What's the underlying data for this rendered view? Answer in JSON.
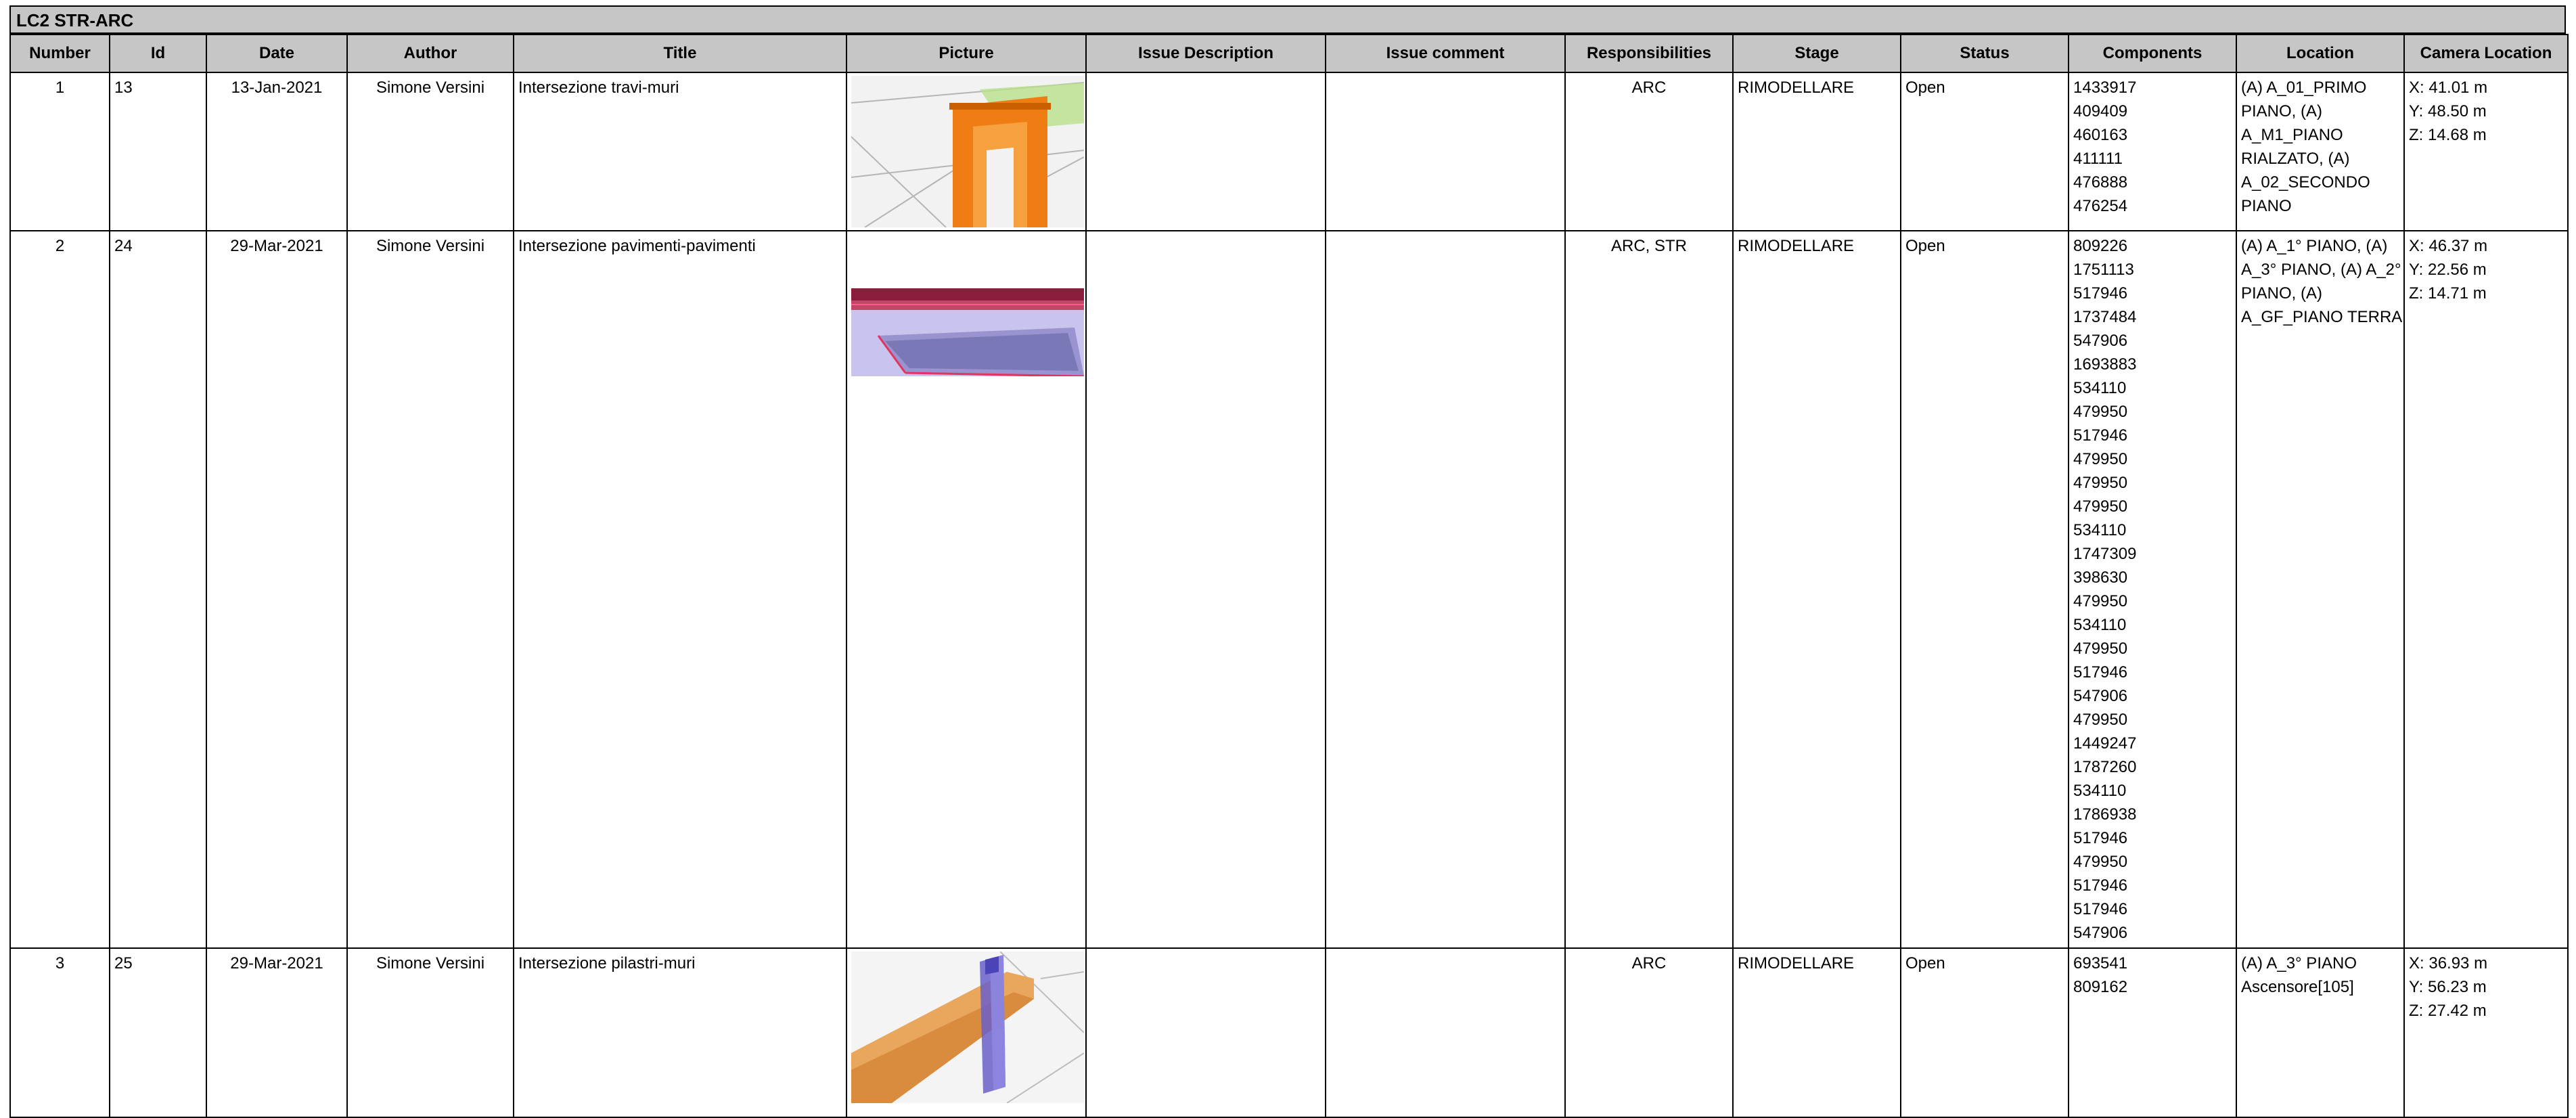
{
  "report": {
    "title": "LC2 STR-ARC"
  },
  "columns": [
    "Number",
    "Id",
    "Date",
    "Author",
    "Title",
    "Picture",
    "Issue Description",
    "Issue comment",
    "Responsibilities",
    "Stage",
    "Status",
    "Components",
    "Location",
    "Camera Location"
  ],
  "rows": [
    {
      "number": "1",
      "id": "13",
      "date": "13-Jan-2021",
      "author": "Simone Versini",
      "title": "Intersezione travi-muri",
      "issue_description": "",
      "issue_comment": "",
      "responsibilities": "ARC",
      "stage": "RIMODELLARE",
      "status": "Open",
      "components": [
        "1433917",
        "409409",
        "460163",
        "411111",
        "476888",
        "476254"
      ],
      "location": [
        "(A) A_01_PRIMO",
        "PIANO, (A)",
        "A_M1_PIANO",
        "RIALZATO, (A)",
        "A_02_SECONDO",
        "PIANO"
      ],
      "camera": [
        "X: 41.01 m",
        "Y: 48.50 m",
        "Z: 14.68 m"
      ],
      "picture_icon": "orange-beam-wall-clash-render"
    },
    {
      "number": "2",
      "id": "24",
      "date": "29-Mar-2021",
      "author": "Simone Versini",
      "title": "Intersezione pavimenti-pavimenti",
      "issue_description": "",
      "issue_comment": "",
      "responsibilities": "ARC, STR",
      "stage": "RIMODELLARE",
      "status": "Open",
      "components": [
        "809226",
        "1751113",
        "517946",
        "1737484",
        "547906",
        "1693883",
        "534110",
        "479950",
        "517946",
        "479950",
        "479950",
        "479950",
        "534110",
        "1747309",
        "398630",
        "479950",
        "534110",
        "479950",
        "517946",
        "547906",
        "479950",
        "1449247",
        "1787260",
        "534110",
        "1786938",
        "517946",
        "479950",
        "517946",
        "517946",
        "547906"
      ],
      "location": [
        "(A) A_1° PIANO, (A)",
        "A_3° PIANO, (A) A_2°",
        "PIANO, (A)",
        "A_GF_PIANO TERRA"
      ],
      "camera": [
        "X: 46.37 m",
        "Y: 22.56 m",
        "Z: 14.71 m"
      ],
      "picture_icon": "purple-floor-slab-clash-render"
    },
    {
      "number": "3",
      "id": "25",
      "date": "29-Mar-2021",
      "author": "Simone Versini",
      "title": "Intersezione pilastri-muri",
      "issue_description": "",
      "issue_comment": "",
      "responsibilities": "ARC",
      "stage": "RIMODELLARE",
      "status": "Open",
      "components": [
        "693541",
        "809162"
      ],
      "location": [
        "(A) A_3° PIANO",
        "Ascensore[105]"
      ],
      "camera": [
        "X: 36.93 m",
        "Y: 56.23 m",
        "Z: 27.42 m"
      ],
      "picture_icon": "column-wall-clash-render"
    }
  ]
}
